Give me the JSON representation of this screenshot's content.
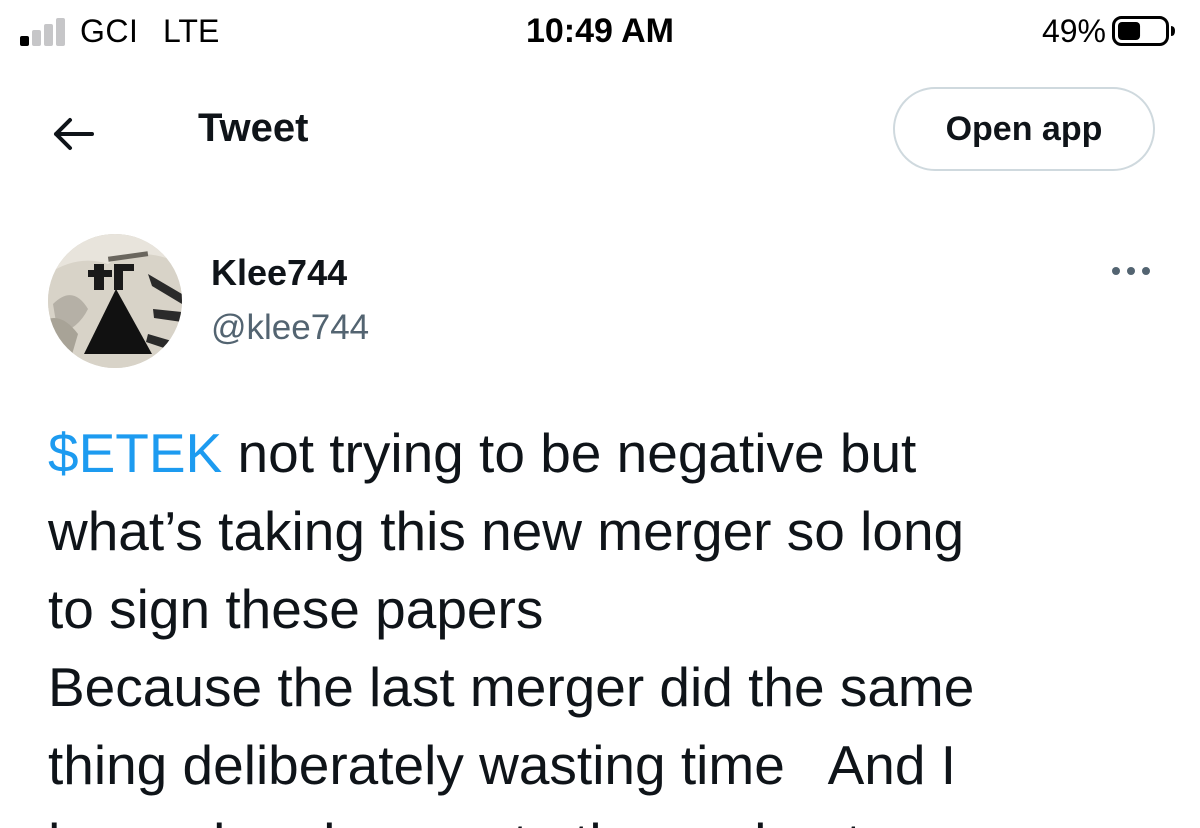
{
  "status_bar": {
    "carrier": "GCI",
    "network": "LTE",
    "time": "10:49 AM",
    "battery_percent": "49%",
    "battery_level": 0.49,
    "signal_bars_active": 1,
    "signal_bars_total": 4
  },
  "header": {
    "title": "Tweet",
    "back_icon": "arrow-left-icon",
    "open_app_label": "Open app"
  },
  "tweet": {
    "author": {
      "display_name": "Klee744",
      "handle": "@klee744"
    },
    "more_icon": "more-horizontal-icon",
    "cashtag": "$ETEK",
    "lines": [
      " not trying to be negative but",
      "what’s taking this new merger so long",
      "to sign these papers",
      "Because the last merger did the same",
      "thing deliberately wasting time   And I"
    ],
    "cut_off_line": "have already seen to the worker to"
  },
  "colors": {
    "link": "#1d9bf0",
    "text_primary": "#0f1419",
    "text_secondary": "#536471",
    "border": "#cfd9de"
  }
}
